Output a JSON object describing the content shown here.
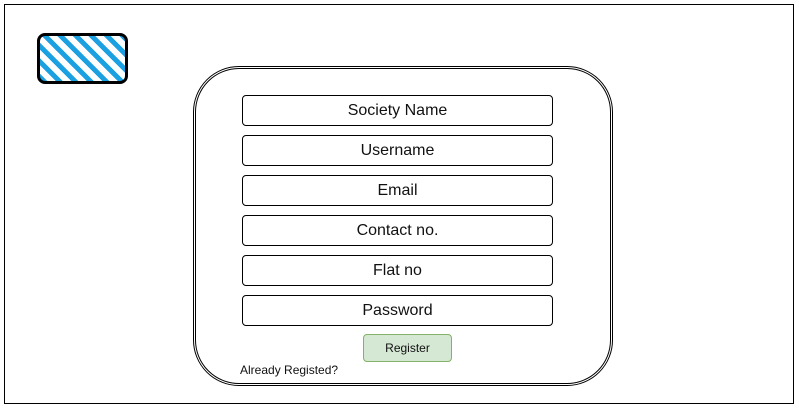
{
  "fields": [
    "Society Name",
    "Username",
    "Email",
    "Contact no.",
    "Flat no",
    "Password"
  ],
  "register_label": "Register",
  "already_registered": "Already Registed?",
  "colors": {
    "logo": "#1ba1e2",
    "button_fill": "#d5e8d4",
    "button_border": "#82b366"
  }
}
